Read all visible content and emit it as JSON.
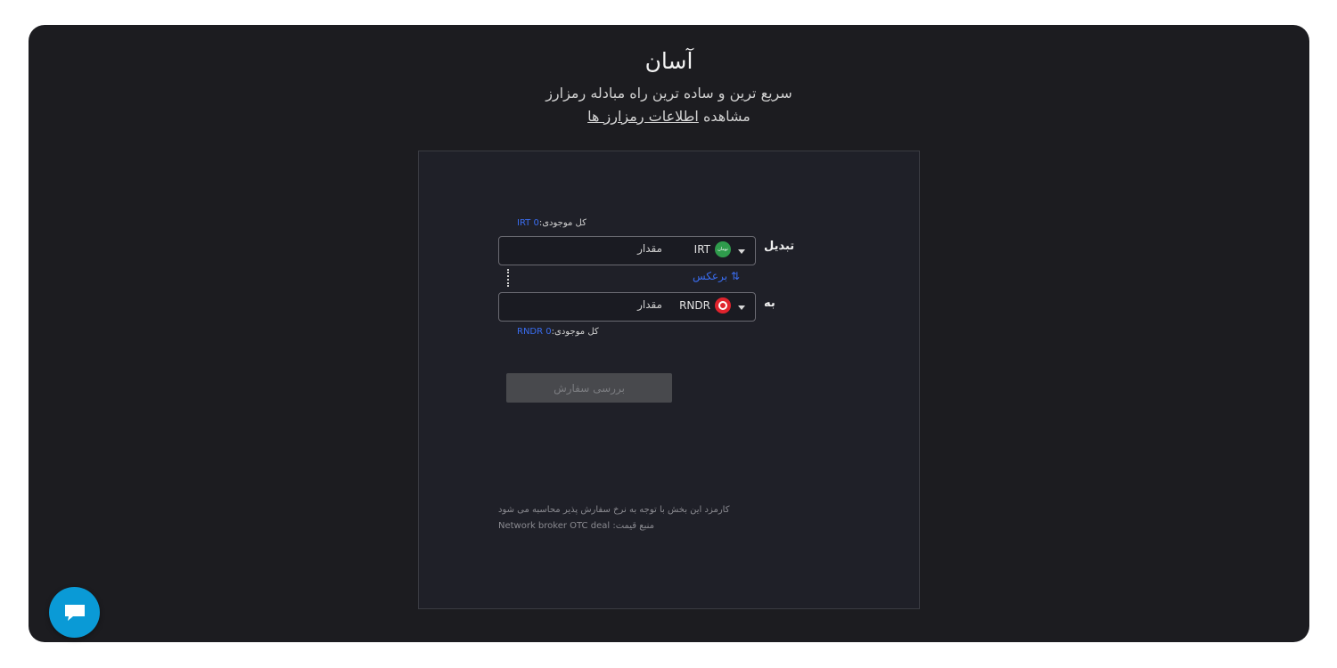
{
  "header": {
    "title": "آسان",
    "subtitle": "سریع ترین و ساده ترین راه مبادله رمزارز",
    "info_prefix": "مشاهده",
    "info_link": "اطلاعات رمزارز ها"
  },
  "exchange": {
    "from": {
      "label": "تبدیل",
      "balance_label": "کل موجودی:",
      "balance_value": "IRT 0",
      "currency": "IRT",
      "currency_icon_text": "تومان",
      "amount_placeholder": "مقدار"
    },
    "swap_label": "برعکس",
    "swap_icon": "⇅",
    "to": {
      "label": "به",
      "balance_label": "کل موجودی:",
      "balance_value": "RNDR 0",
      "currency": "RNDR",
      "amount_placeholder": "مقدار"
    },
    "submit_label": "بررسی سفارش",
    "fee_note": "کارمزد این بخش با توجه به نرخ سفارش پذیر محاسبه می شود",
    "price_source": "منبع قیمت: Network broker OTC deal"
  },
  "colors": {
    "background": "#1c1c20",
    "card": "#1f2028",
    "accent": "#3a6df0",
    "chat": "#0a9ad6"
  },
  "icons": {
    "chat": "chat-bubble-icon",
    "caret": "chevron-down-icon",
    "swap": "swap-arrows-icon"
  }
}
